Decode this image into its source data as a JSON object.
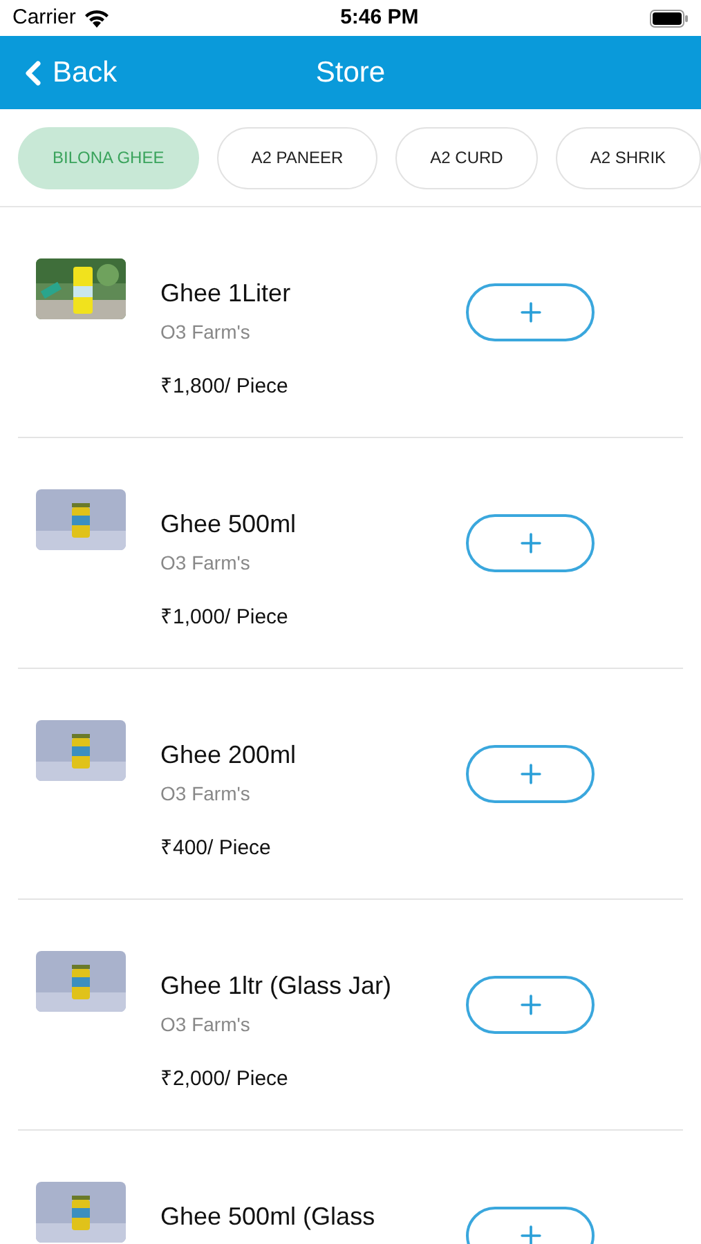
{
  "status_bar": {
    "carrier": "Carrier",
    "time": "5:46 PM"
  },
  "header": {
    "back": "Back",
    "title": "Store"
  },
  "categories": [
    {
      "label": "BILONA GHEE",
      "selected": true
    },
    {
      "label": "A2 PANEER",
      "selected": false
    },
    {
      "label": "A2 CURD",
      "selected": false
    },
    {
      "label": "A2 SHRIK",
      "selected": false
    }
  ],
  "products": [
    {
      "name": "Ghee 1Liter",
      "brand": "O3 Farm's",
      "price": "₹1,800/ Piece"
    },
    {
      "name": "Ghee 500ml",
      "brand": "O3 Farm's",
      "price": "₹1,000/ Piece"
    },
    {
      "name": "Ghee 200ml",
      "brand": "O3 Farm's",
      "price": "₹400/ Piece"
    },
    {
      "name": "Ghee 1ltr (Glass Jar)",
      "brand": "O3 Farm's",
      "price": "₹2,000/ Piece"
    },
    {
      "name": "Ghee 500ml (Glass"
    }
  ]
}
